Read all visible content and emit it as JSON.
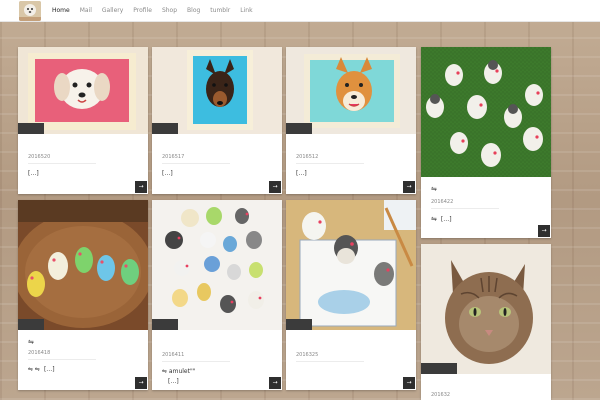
{
  "nav": {
    "items": [
      "Home",
      "Mail",
      "Gallery",
      "Profile",
      "Shop",
      "Blog",
      "tumblr",
      "Link"
    ],
    "active": "Home"
  },
  "cards": [
    {
      "date": "2016520",
      "excerpt": "[…]",
      "icon": "",
      "title": ""
    },
    {
      "date": "2016517",
      "excerpt": "[…]",
      "icon": "",
      "title": ""
    },
    {
      "date": "2016512",
      "excerpt": "[…]",
      "icon": "",
      "title": ""
    },
    {
      "date": "2016422",
      "excerpt": "[…]",
      "icon": "⇋",
      "title": "⇋"
    },
    {
      "date": "2016418",
      "excerpt": "[…]",
      "icon": "⇋",
      "title": "⇋ ⇋"
    },
    {
      "date": "2016411",
      "excerpt": "[…]",
      "icon": "",
      "title": "⇋ amulet\"\""
    },
    {
      "date": "2016325",
      "excerpt": "",
      "icon": "",
      "title": ""
    },
    {
      "date": "201632",
      "excerpt": "",
      "icon": "",
      "title": ""
    }
  ],
  "arrow_glyph": "→",
  "colors": {
    "nav_active": "#222222",
    "nav_inactive": "#8a8a8a",
    "badge": "#3b3b3b",
    "arrow_button": "#2f2f2f"
  },
  "icons": {
    "logo": "felt-dog-logo",
    "arrow": "arrow-right-icon",
    "shuffle": "shuffle-icon"
  }
}
